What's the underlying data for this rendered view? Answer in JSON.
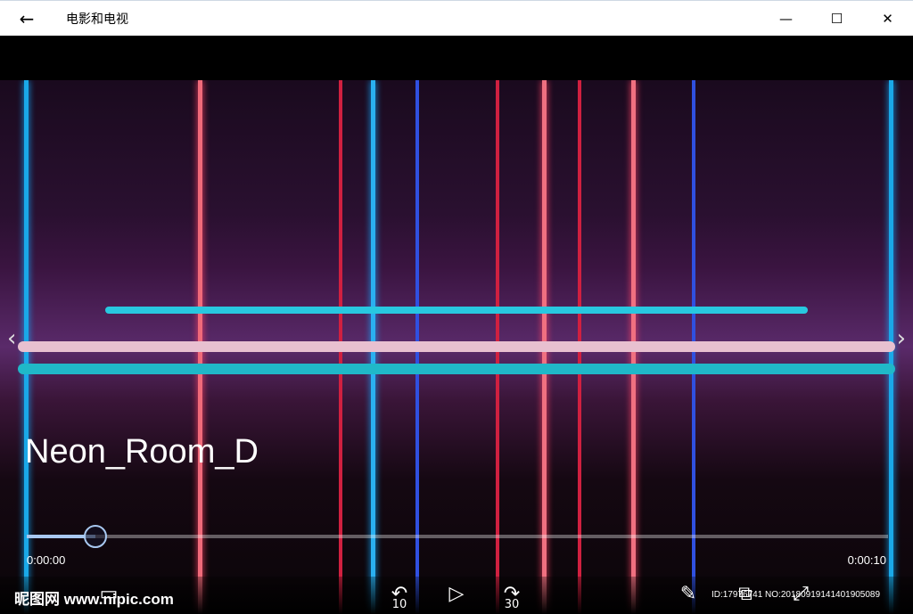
{
  "app": {
    "title": "电影和电视"
  },
  "video": {
    "title": "Neon_Room_D",
    "current_time": "0:00:00",
    "duration": "0:00:10",
    "progress": 0.08
  },
  "controls": {
    "rewind_label": "10",
    "forward_label": "30"
  },
  "watermark": {
    "left": "昵图网 www.nipic.com",
    "right": "ID:17976741 NO:20180919141401905089"
  },
  "colors": {
    "accent": "#a8c8f0"
  }
}
